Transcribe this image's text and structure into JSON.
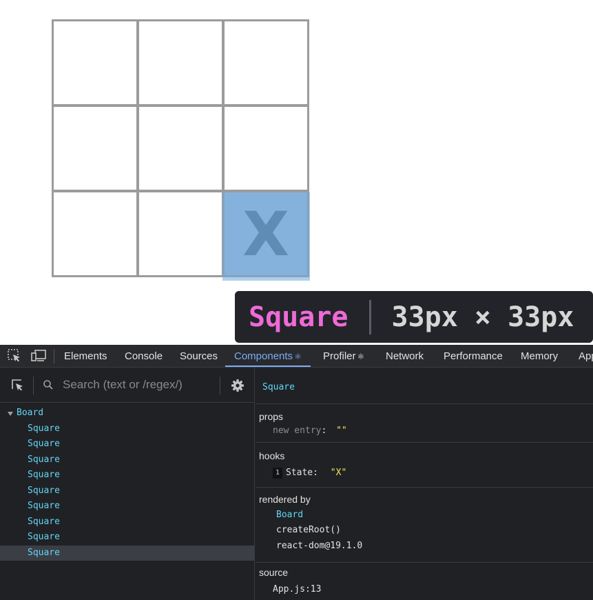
{
  "board": {
    "squares": [
      "",
      "",
      "",
      "",
      "",
      "",
      "",
      "",
      "X"
    ],
    "highlighted_index": 8
  },
  "tooltip": {
    "component": "Square",
    "size": "33px × 33px"
  },
  "devtools": {
    "tabs": [
      {
        "label": "Elements",
        "active": false
      },
      {
        "label": "Console",
        "active": false
      },
      {
        "label": "Sources",
        "active": false
      },
      {
        "label": "Components",
        "active": true,
        "icon": "react-atom-icon"
      },
      {
        "label": "Profiler",
        "active": false,
        "icon": "react-atom-icon"
      },
      {
        "label": "Network",
        "active": false
      },
      {
        "label": "Performance",
        "active": false
      },
      {
        "label": "Memory",
        "active": false
      },
      {
        "label": "App",
        "active": false
      }
    ],
    "atom_glyph": "⚛",
    "search": {
      "placeholder": "Search (text or /regex/)",
      "value": ""
    },
    "tree": {
      "root": "Board",
      "children": [
        "Square",
        "Square",
        "Square",
        "Square",
        "Square",
        "Square",
        "Square",
        "Square",
        "Square"
      ],
      "selected_child_index": 8
    },
    "inspector": {
      "selected_component": "Square",
      "props": {
        "title": "props",
        "new_entry_key": "new entry",
        "colon": ":",
        "new_entry_value": "\"\""
      },
      "hooks": {
        "title": "hooks",
        "items": [
          {
            "index": "1",
            "name": "State",
            "colon": ":",
            "value": "\"X\""
          }
        ]
      },
      "rendered_by": {
        "title": "rendered by",
        "items": [
          "Board",
          "createRoot()",
          "react-dom@19.1.0"
        ]
      },
      "source": {
        "title": "source",
        "location": "App.js:13"
      }
    },
    "colors": {
      "background": "#202124",
      "component_name": "#61d5f5",
      "string_value": "#f0e35a",
      "active_tab": "#7cacf8",
      "tooltip_name": "#ef6ad8",
      "highlight": "#6fa8dc"
    }
  }
}
